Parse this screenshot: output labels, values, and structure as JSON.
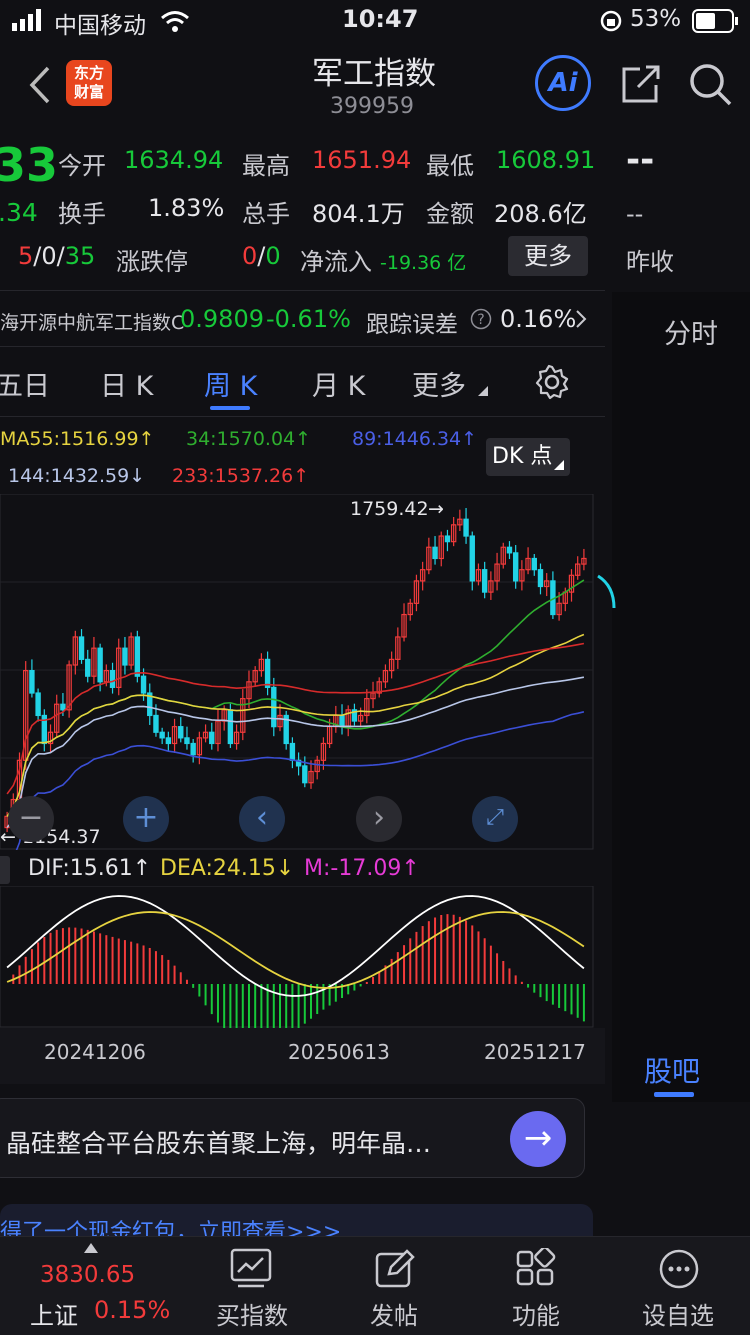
{
  "status": {
    "carrier": "中国移动",
    "time": "10:47",
    "battery": "53%"
  },
  "nav": {
    "title": "军工指数",
    "code": "399959",
    "logo_line1": "东方",
    "logo_line2": "财富",
    "ai_label": "Ai"
  },
  "quote": {
    "price_partial": "33",
    "change_partial": ".34",
    "open_label": "今开",
    "open": "1634.94",
    "high_label": "最高",
    "high": "1651.94",
    "low_label": "最低",
    "low": "1608.91",
    "turnover_label": "换手",
    "turnover": "1.83%",
    "volume_label": "总手",
    "volume": "804.1万",
    "amount_label": "金额",
    "amount": "208.6亿",
    "adv_up": "5",
    "adv_sep1": "/",
    "adv_flat": "0",
    "adv_sep2": "/",
    "adv_down": "35",
    "limit_label": "涨跌停",
    "limit_up": "0",
    "limit_sep": "/",
    "limit_down": "0",
    "netflow_label": "净流入",
    "netflow": "-19.36 亿",
    "more_label": "更多",
    "side_dash": "--",
    "side_dash2": "--",
    "prev_close_label": "昨收"
  },
  "fund": {
    "name": "海开源中航军工指数C",
    "value": "0.9809",
    "change": "-0.61%",
    "track_label": "跟踪误差",
    "track_value": "0.16%"
  },
  "right_tabs": {
    "intraday": "分时",
    "guba": "股吧"
  },
  "tabs": [
    {
      "label": "五日",
      "selected": false
    },
    {
      "label": "日 K",
      "selected": false
    },
    {
      "label": "周 K",
      "selected": true
    },
    {
      "label": "月 K",
      "selected": false
    },
    {
      "label": "更多",
      "selected": false
    }
  ],
  "ma": {
    "ma55": "MA55:1516.99↑",
    "ma34": "34:1570.04↑",
    "ma89": "89:1446.34↑",
    "ma144": "144:1432.59↓",
    "ma233": "233:1537.26↑",
    "dk_label": "DK 点"
  },
  "chart_data": {
    "type": "candlestick",
    "period": "weekly",
    "max_label": "1759.42",
    "min_label": "1154.37",
    "x_ticks": [
      "20241206",
      "20250613",
      "20251217"
    ],
    "colors": {
      "up": "#f23b3b",
      "down": "#22d3e6",
      "ma55": "#e6d340",
      "ma34": "#2fae2f",
      "ma89": "#3b4fd6",
      "ma144": "#b8c6e8",
      "ma233": "#d62b2b",
      "dif": "#ffffff",
      "dea": "#e6d340"
    },
    "macd": {
      "dif": "DIF:15.61↑",
      "dea": "DEA:24.15↓",
      "m": "M:-17.09↑"
    }
  },
  "chat": {
    "placeholder": "晶硅整合平台股东首聚上海，明年晶…"
  },
  "banner": {
    "text": "得了一个现金红包，立即查看>>>"
  },
  "bottom": {
    "index_value": "3830.65",
    "index_name": "上证",
    "index_change": "0.15%",
    "items": [
      {
        "label": "买指数",
        "icon": "chart-icon"
      },
      {
        "label": "发帖",
        "icon": "edit-icon"
      },
      {
        "label": "功能",
        "icon": "grid-icon"
      },
      {
        "label": "设自选",
        "icon": "more-icon"
      }
    ]
  }
}
